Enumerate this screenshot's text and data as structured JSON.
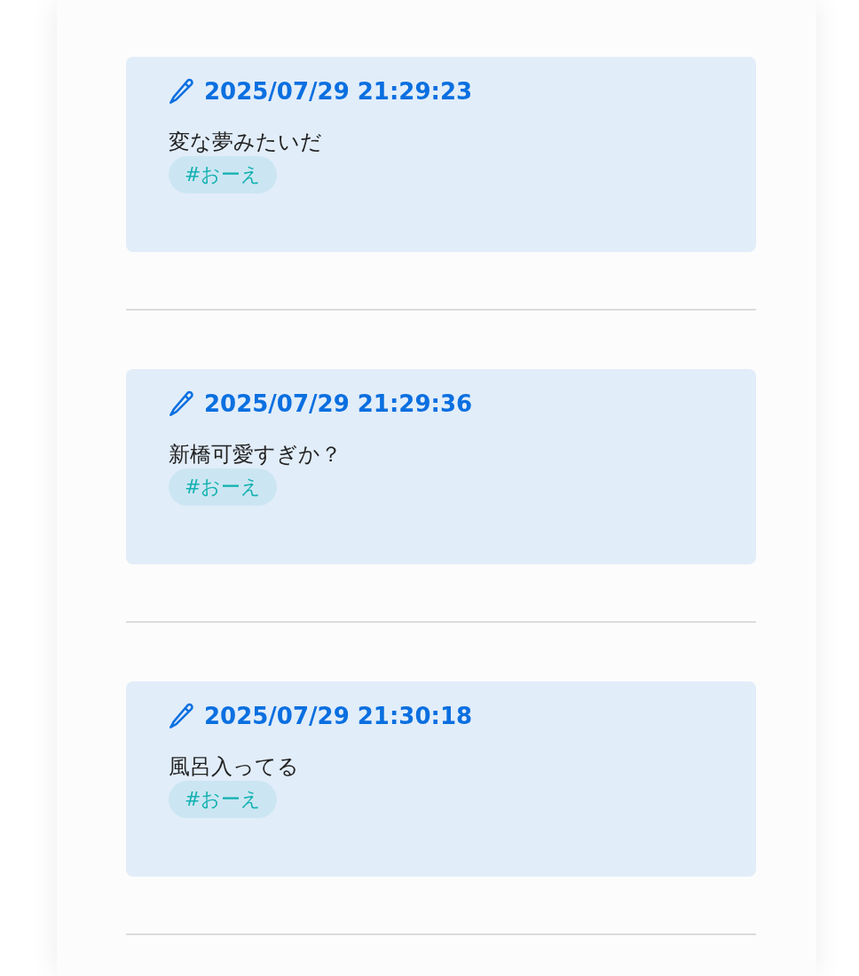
{
  "posts": [
    {
      "timestamp": "2025/07/29 21:29:23",
      "text": "変な夢みたいだ",
      "tags": [
        "#おーえ"
      ]
    },
    {
      "timestamp": "2025/07/29 21:29:36",
      "text": "新橋可愛すぎか？",
      "tags": [
        "#おーえ"
      ]
    },
    {
      "timestamp": "2025/07/29 21:30:18",
      "text": "風呂入ってる",
      "tags": [
        "#おーえ"
      ]
    }
  ]
}
